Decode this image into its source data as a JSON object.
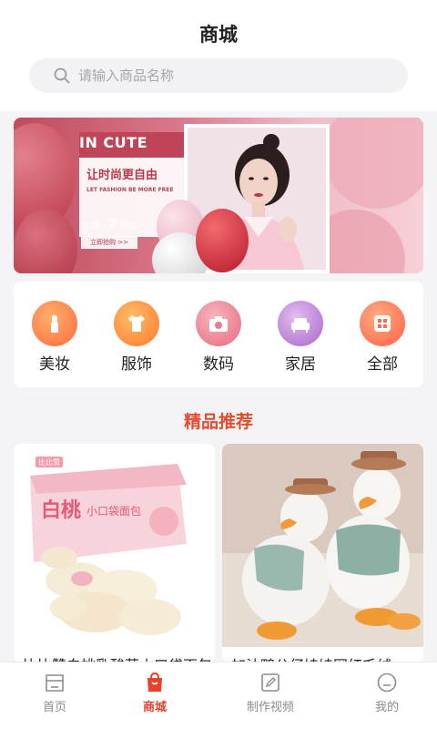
{
  "header": {
    "title": "商城"
  },
  "search": {
    "placeholder": "请输入商品名称"
  },
  "banner": {
    "brand": "IN CUTE",
    "slogan": "让时尚更自由",
    "slogan_en": "LET FASHION BE MORE FREE",
    "discount_prefix": "全场",
    "discount_value": "7",
    "discount_suffix": "折起",
    "cta_label": "立即抢购 >>"
  },
  "categories": [
    {
      "label": "美妆",
      "icon": "lipstick-icon",
      "color_from": "#ff9f57",
      "color_to": "#ff6a3d"
    },
    {
      "label": "服饰",
      "icon": "tshirt-icon",
      "color_from": "#ffa94d",
      "color_to": "#ff7a2f"
    },
    {
      "label": "数码",
      "icon": "camera-icon",
      "color_from": "#f5a3ae",
      "color_to": "#e56a7c"
    },
    {
      "label": "家居",
      "icon": "sofa-icon",
      "color_from": "#d6a8e8",
      "color_to": "#a766cc"
    },
    {
      "label": "全部",
      "icon": "grid-icon",
      "color_from": "#ff9a6a",
      "color_to": "#ff5e47"
    }
  ],
  "section": {
    "title": "精品推荐"
  },
  "products": [
    {
      "title": "比比赞白桃乳酸菜小口袋面包",
      "image": "bread-box-image"
    },
    {
      "title": "加油鸭公仔娃娃网红毛绒",
      "image": "duck-plush-image"
    }
  ],
  "tabbar": {
    "items": [
      {
        "label": "首页",
        "icon": "home-icon",
        "active": false
      },
      {
        "label": "商城",
        "icon": "shopping-bag-icon",
        "active": true
      },
      {
        "label": "制作视频",
        "icon": "edit-icon",
        "active": false
      },
      {
        "label": "我的",
        "icon": "profile-icon",
        "active": false
      }
    ]
  },
  "colors": {
    "accent": "#e8422d",
    "section_title": "#e54b2e",
    "tab_inactive": "#8c8c8c"
  }
}
